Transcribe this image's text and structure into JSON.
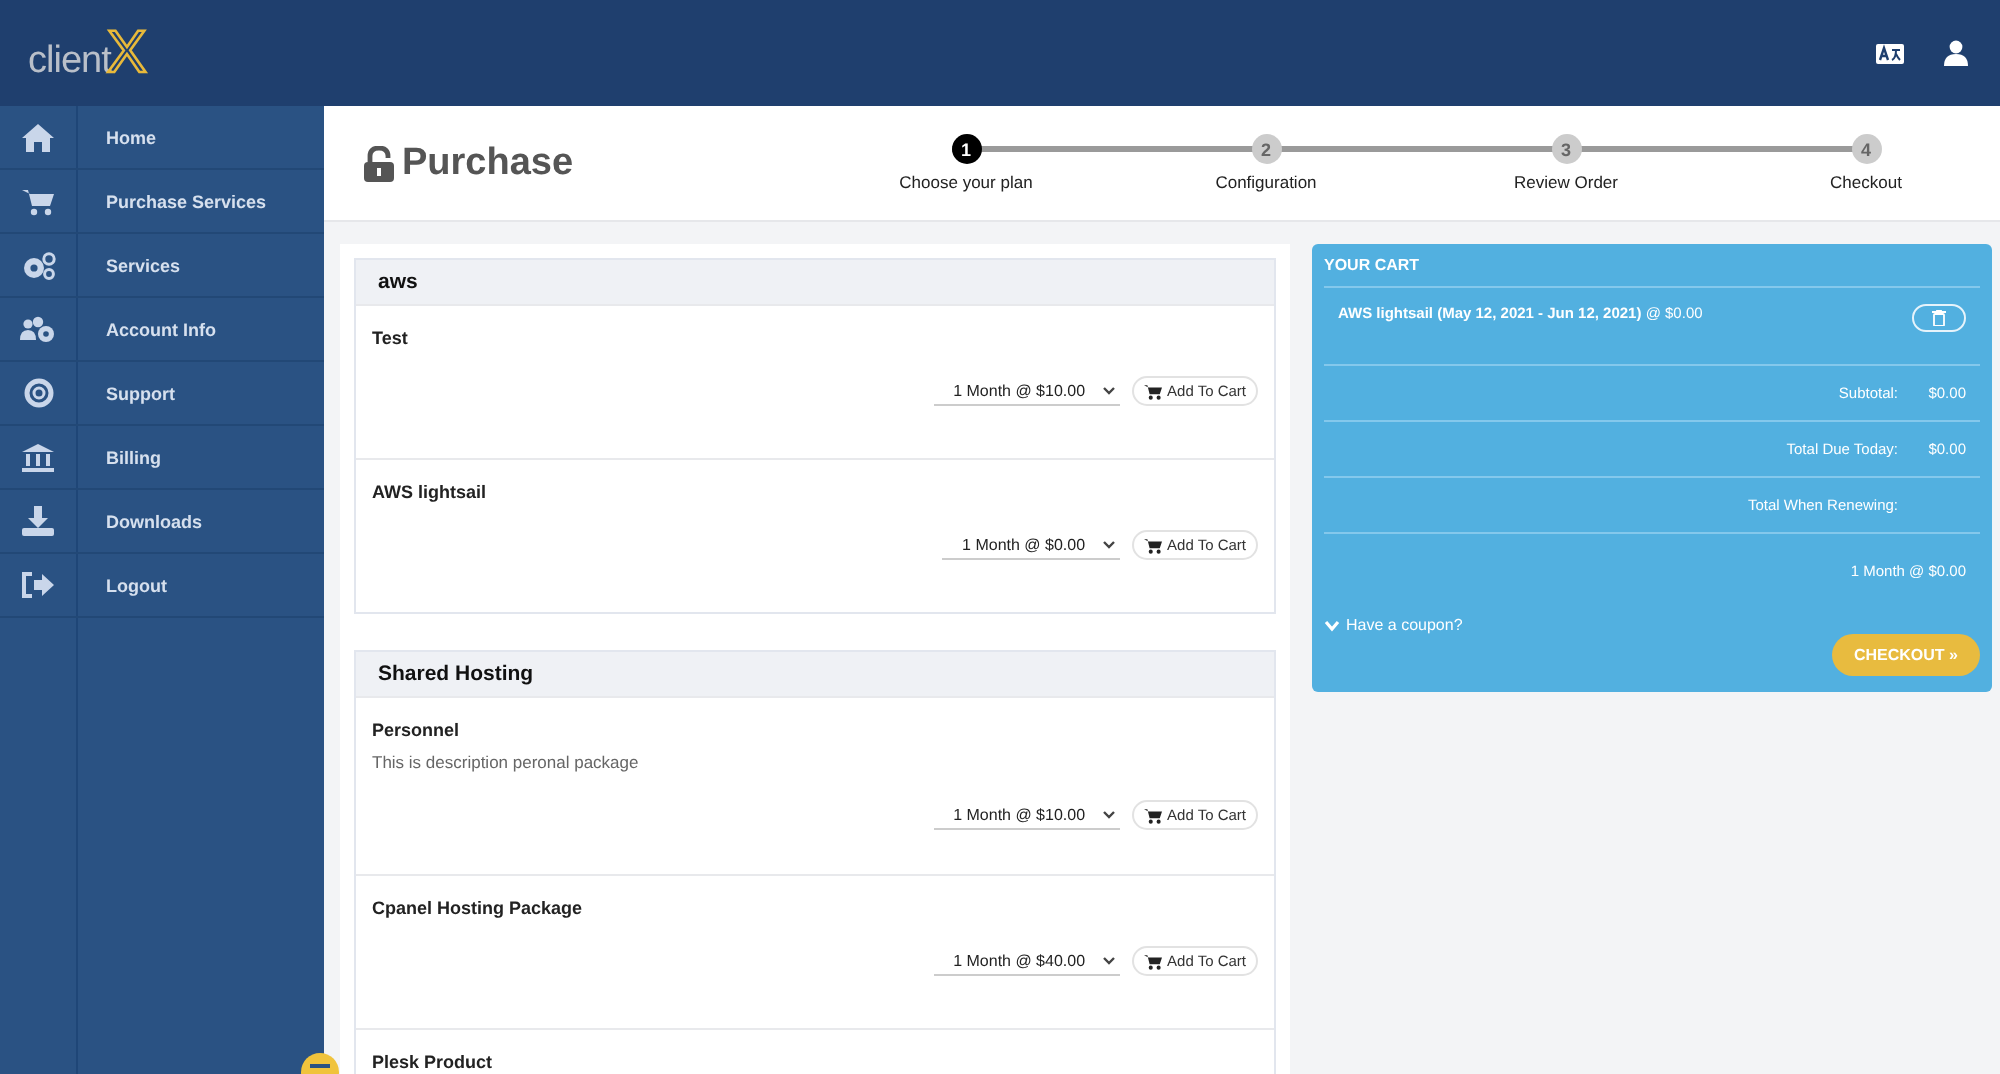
{
  "logo": {
    "text": "client",
    "mark": "X"
  },
  "sidebar": {
    "items": [
      {
        "label": "Home",
        "selected": false
      },
      {
        "label": "Purchase Services",
        "selected": false
      },
      {
        "label": "Services",
        "selected": false
      },
      {
        "label": "Account Info",
        "selected": false
      },
      {
        "label": "Support",
        "selected": false
      },
      {
        "label": "Billing",
        "selected": false
      },
      {
        "label": "Downloads",
        "selected": false
      },
      {
        "label": "Logout",
        "selected": false
      }
    ]
  },
  "page_title": "Purchase",
  "steps": [
    {
      "number": "1",
      "label": "Choose your plan",
      "selected": true
    },
    {
      "number": "2",
      "label": "Configuration",
      "selected": false
    },
    {
      "number": "3",
      "label": "Review Order",
      "selected": false
    },
    {
      "number": "4",
      "label": "Checkout",
      "selected": false
    }
  ],
  "groups": [
    {
      "title": "aws",
      "products": [
        {
          "name": "Test",
          "price": "1 Month @ $10.00",
          "button": "Add To Cart"
        },
        {
          "name": "AWS lightsail",
          "price": "1 Month @ $0.00",
          "button": "Add To Cart"
        }
      ]
    },
    {
      "title": "Shared Hosting",
      "products": [
        {
          "name": "Personnel",
          "description": "This is description peronal package",
          "price": "1 Month @ $10.00",
          "button": "Add To Cart"
        },
        {
          "name": "Cpanel Hosting Package",
          "price": "1 Month @ $40.00",
          "button": "Add To Cart"
        },
        {
          "name": "Plesk Product"
        }
      ]
    }
  ],
  "cart": {
    "title": "YOUR CART",
    "item": "**AWS lightsail (May 12, 2021 - Jun 12, 2021)** @ $0.00",
    "totals": [
      {
        "label": "Subtotal:",
        "value": "$0.00"
      },
      {
        "label": "Total Due Today:",
        "value": "$0.00"
      },
      {
        "label": "Total When Renewing:"
      }
    ],
    "renewal": "1 Month @ $0.00",
    "coupon": "Have a coupon?",
    "checkout": "CHECKOUT »"
  }
}
